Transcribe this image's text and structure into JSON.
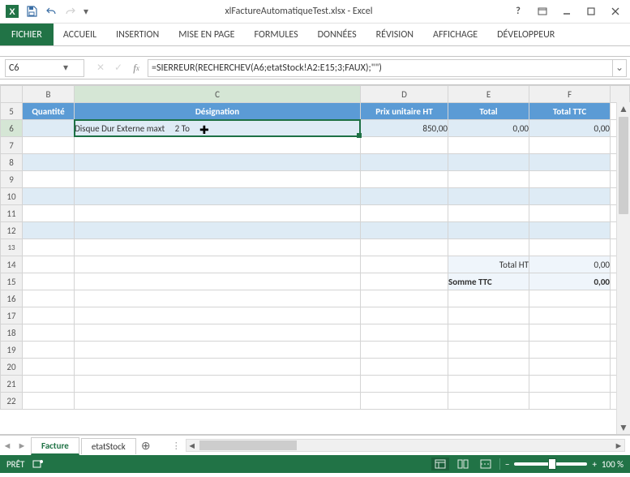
{
  "window": {
    "title": "xlFactureAutomatiqueTest.xlsx - Excel"
  },
  "ribbon": {
    "file": "FICHIER",
    "tabs": [
      "ACCUEIL",
      "INSERTION",
      "MISE EN PAGE",
      "FORMULES",
      "DONNÉES",
      "RÉVISION",
      "AFFICHAGE",
      "DÉVELOPPEUR"
    ]
  },
  "namebox": "C6",
  "formula": "=SIERREUR(RECHERCHEV(A6;etatStock!A2:E15;3;FAUX);\"\")",
  "columns": [
    "B",
    "C",
    "D",
    "E",
    "F"
  ],
  "rows_visible": [
    "5",
    "6",
    "7",
    "8",
    "9",
    "10",
    "11",
    "12",
    "13",
    "14",
    "15",
    "16",
    "17",
    "18",
    "19",
    "20",
    "21",
    "22"
  ],
  "headers": {
    "B": "Quantité",
    "C": "Désignation",
    "D": "Prix unitaire HT",
    "E": "Total",
    "F": "Total TTC"
  },
  "row6": {
    "C": "Disque Dur Externe maxt     2 To",
    "D": "850,00",
    "E": "0,00",
    "F": "0,00"
  },
  "summary": {
    "total_ht_label": "Total HT",
    "total_ht_value": "0,00",
    "somme_ttc_label": "Somme TTC",
    "somme_ttc_value": "0,00"
  },
  "sheet_tabs": {
    "active": "Facture",
    "other": "etatStock"
  },
  "status": {
    "ready": "PRÊT",
    "zoom": "100 %"
  }
}
